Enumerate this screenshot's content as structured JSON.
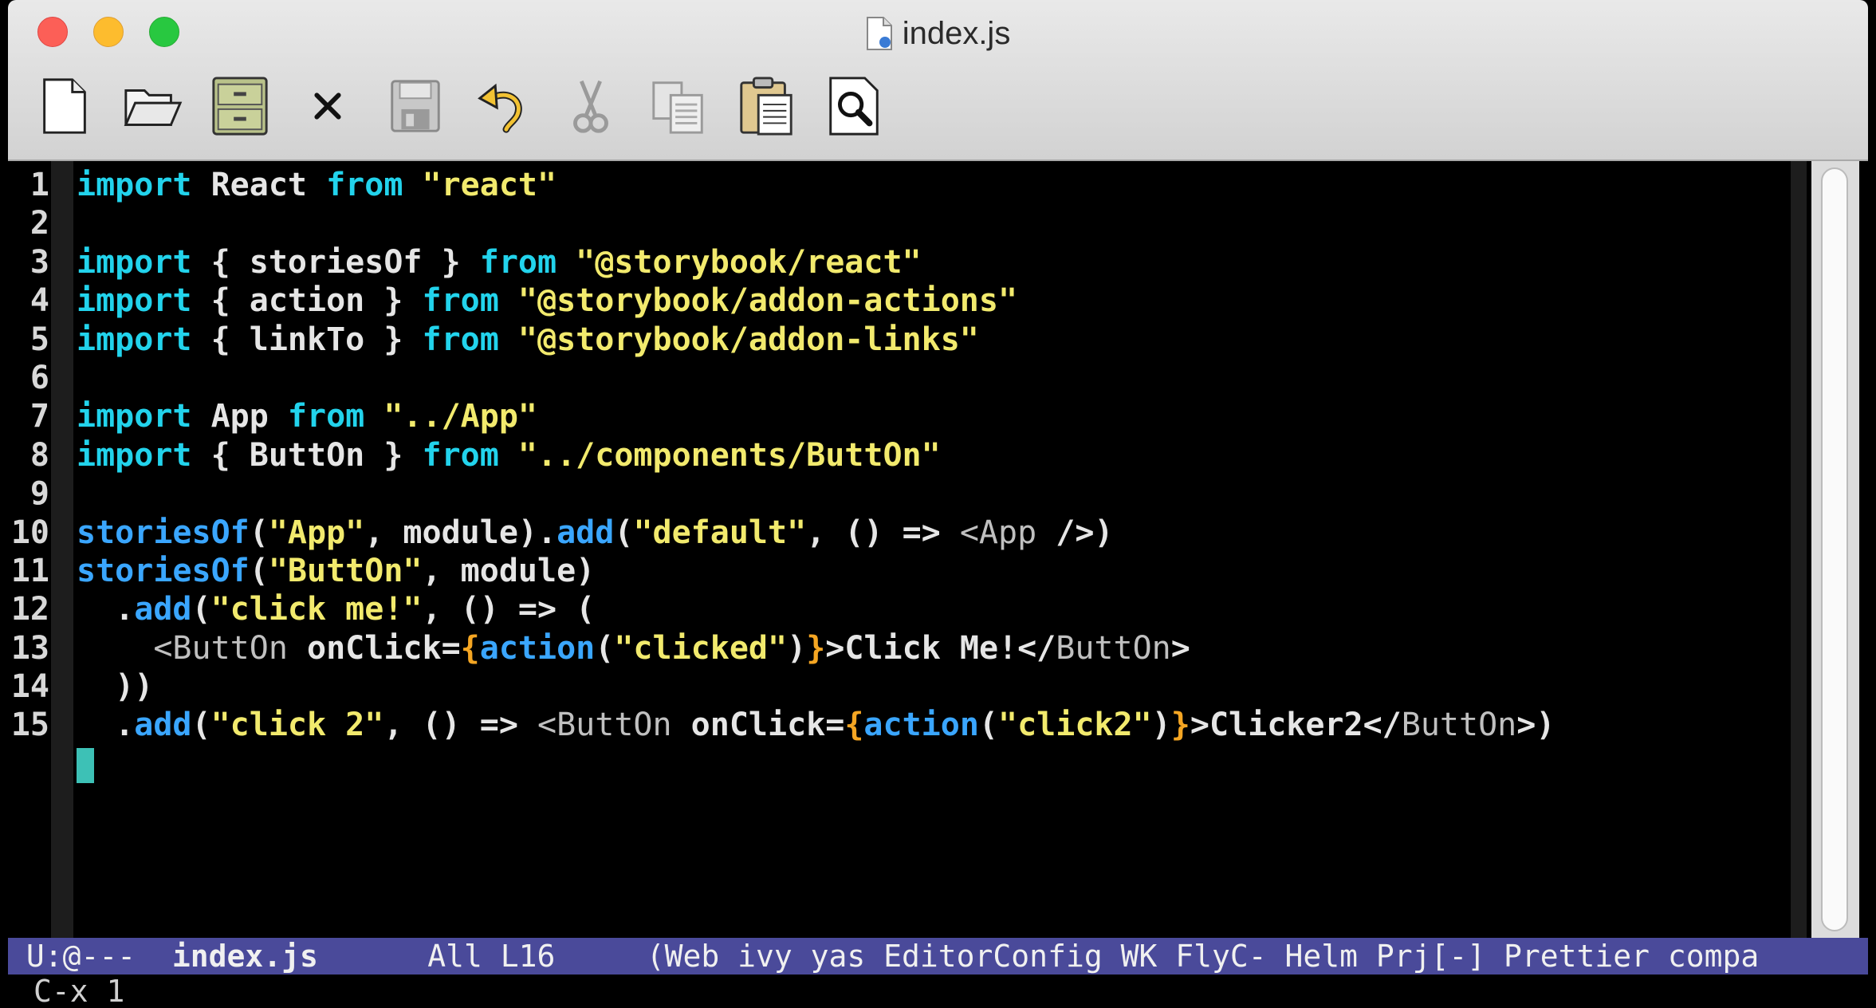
{
  "window": {
    "title": "index.js"
  },
  "toolbar": [
    {
      "name": "new-file-icon"
    },
    {
      "name": "open-folder-icon"
    },
    {
      "name": "file-cabinet-icon"
    },
    {
      "name": "close-x-icon"
    },
    {
      "name": "save-icon"
    },
    {
      "name": "undo-icon"
    },
    {
      "name": "cut-icon"
    },
    {
      "name": "copy-icon"
    },
    {
      "name": "paste-icon"
    },
    {
      "name": "search-icon"
    }
  ],
  "code": {
    "lines": [
      {
        "n": "1",
        "tokens": [
          [
            "kw",
            "import"
          ],
          [
            "plain",
            " React "
          ],
          [
            "kw",
            "from"
          ],
          [
            "plain",
            " "
          ],
          [
            "str",
            "\"react\""
          ]
        ]
      },
      {
        "n": "2",
        "tokens": []
      },
      {
        "n": "3",
        "tokens": [
          [
            "kw",
            "import"
          ],
          [
            "plain",
            " { storiesOf } "
          ],
          [
            "kw",
            "from"
          ],
          [
            "plain",
            " "
          ],
          [
            "str",
            "\"@storybook/react\""
          ]
        ]
      },
      {
        "n": "4",
        "tokens": [
          [
            "kw",
            "import"
          ],
          [
            "plain",
            " { action } "
          ],
          [
            "kw",
            "from"
          ],
          [
            "plain",
            " "
          ],
          [
            "str",
            "\"@storybook/addon-actions\""
          ]
        ]
      },
      {
        "n": "5",
        "tokens": [
          [
            "kw",
            "import"
          ],
          [
            "plain",
            " { linkTo } "
          ],
          [
            "kw",
            "from"
          ],
          [
            "plain",
            " "
          ],
          [
            "str",
            "\"@storybook/addon-links\""
          ]
        ]
      },
      {
        "n": "6",
        "tokens": []
      },
      {
        "n": "7",
        "tokens": [
          [
            "kw",
            "import"
          ],
          [
            "plain",
            " App "
          ],
          [
            "kw",
            "from"
          ],
          [
            "plain",
            " "
          ],
          [
            "str",
            "\"../App\""
          ]
        ]
      },
      {
        "n": "8",
        "tokens": [
          [
            "kw",
            "import"
          ],
          [
            "plain",
            " { ButtOn } "
          ],
          [
            "kw",
            "from"
          ],
          [
            "plain",
            " "
          ],
          [
            "str",
            "\"../components/ButtOn\""
          ]
        ]
      },
      {
        "n": "9",
        "tokens": []
      },
      {
        "n": "10",
        "tokens": [
          [
            "fn",
            "storiesOf"
          ],
          [
            "plain",
            "("
          ],
          [
            "str",
            "\"App\""
          ],
          [
            "plain",
            ", module)."
          ],
          [
            "fn",
            "add"
          ],
          [
            "plain",
            "("
          ],
          [
            "str",
            "\"default\""
          ],
          [
            "plain",
            ", () => "
          ],
          [
            "tag",
            "<App"
          ],
          [
            "plain",
            " />)"
          ]
        ]
      },
      {
        "n": "11",
        "tokens": [
          [
            "fn",
            "storiesOf"
          ],
          [
            "plain",
            "("
          ],
          [
            "str",
            "\"ButtOn\""
          ],
          [
            "plain",
            ", module)"
          ]
        ]
      },
      {
        "n": "12",
        "tokens": [
          [
            "plain",
            "  ."
          ],
          [
            "fn",
            "add"
          ],
          [
            "plain",
            "("
          ],
          [
            "str",
            "\"click me!\""
          ],
          [
            "plain",
            ", () => ("
          ]
        ]
      },
      {
        "n": "13",
        "tokens": [
          [
            "plain",
            "    "
          ],
          [
            "tag",
            "<ButtOn"
          ],
          [
            "attr",
            " onClick="
          ],
          [
            "brace",
            "{"
          ],
          [
            "fn",
            "action"
          ],
          [
            "plain",
            "("
          ],
          [
            "str",
            "\"clicked\""
          ],
          [
            "plain",
            ")"
          ],
          [
            "brace",
            "}"
          ],
          [
            "plain",
            ">Click Me!</"
          ],
          [
            "tag",
            "ButtOn"
          ],
          [
            "plain",
            ">"
          ]
        ]
      },
      {
        "n": "14",
        "tokens": [
          [
            "plain",
            "  ))"
          ]
        ]
      },
      {
        "n": "15",
        "tokens": [
          [
            "plain",
            "  ."
          ],
          [
            "fn",
            "add"
          ],
          [
            "plain",
            "("
          ],
          [
            "str",
            "\"click 2\""
          ],
          [
            "plain",
            ", () => "
          ],
          [
            "tag",
            "<ButtOn"
          ],
          [
            "attr",
            " onClick="
          ],
          [
            "brace",
            "{"
          ],
          [
            "fn",
            "action"
          ],
          [
            "plain",
            "("
          ],
          [
            "str",
            "\"click2\""
          ],
          [
            "plain",
            ")"
          ],
          [
            "brace",
            "}"
          ],
          [
            "plain",
            ">Clicker2</"
          ],
          [
            "tag",
            "ButtOn"
          ],
          [
            "plain",
            ">)"
          ]
        ]
      },
      {
        "n": "",
        "tokens": [
          [
            "cursor",
            ""
          ]
        ]
      }
    ]
  },
  "modeline": {
    "state": " U:@---  ",
    "buffer": "index.js",
    "position": "      All L16     ",
    "modes": "(Web ivy yas EditorConfig WK FlyC- Helm Prj[-] Prettier compa"
  },
  "minibuffer": {
    "text": "C-x 1"
  }
}
